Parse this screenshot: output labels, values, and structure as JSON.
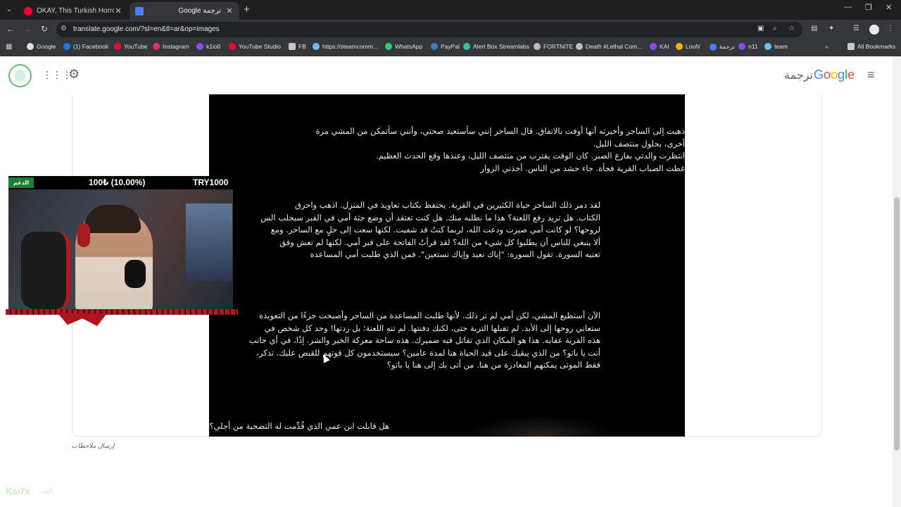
{
  "browser": {
    "tabs": [
      {
        "title": "OKAY, This Turkish Horror Game",
        "icon": "youtube-icon",
        "active": false
      },
      {
        "title": "Google ترجمة",
        "icon": "google-translate-icon",
        "active": true
      }
    ],
    "url": "translate.google.com/?sl=en&tl=ar&op=images",
    "bookmarks": [
      {
        "label": "Google",
        "icon": "google-icon",
        "color": "#dddddd"
      },
      {
        "label": "(1) Facebook",
        "icon": "facebook-icon",
        "color": "#1877f2"
      },
      {
        "label": "YouTube",
        "icon": "youtube-icon",
        "color": "#ff0033"
      },
      {
        "label": "Instagram",
        "icon": "instagram-icon",
        "color": "#e1306c"
      },
      {
        "label": "k1io0",
        "icon": "twitch-icon",
        "color": "#9146ff"
      },
      {
        "label": "YouTube Studio",
        "icon": "youtube-studio-icon",
        "color": "#ff0033"
      },
      {
        "label": "FB",
        "icon": "folder-icon",
        "color": "#c8c8c8"
      },
      {
        "label": "https://steamcomm...",
        "icon": "steam-icon",
        "color": "#66c0f4"
      },
      {
        "label": "WhatsApp",
        "icon": "whatsapp-icon",
        "color": "#25d366"
      },
      {
        "label": "PayPal",
        "icon": "paypal-icon",
        "color": "#3b7bbf"
      },
      {
        "label": "Alert Box Streamlabs",
        "icon": "streamlabs-icon",
        "color": "#31c3a2"
      },
      {
        "label": "FORTNITE",
        "icon": "fortnite-icon",
        "color": "#bbbbbb"
      },
      {
        "label": "Death #Lethal Com...",
        "icon": "discord-icon",
        "color": "#bbbbbb"
      },
      {
        "label": "KAI",
        "icon": "twitch-icon",
        "color": "#9146ff"
      },
      {
        "label": "LooN",
        "icon": "loon-icon",
        "color": "#f4b400"
      },
      {
        "label": "ترجمة",
        "icon": "google-translate-icon",
        "color": "#4c7ef0"
      },
      {
        "label": "n11",
        "icon": "twitch-icon",
        "color": "#9146ff"
      },
      {
        "label": "team",
        "icon": "steam-icon",
        "color": "#66c0f4"
      }
    ],
    "all_bookmarks": "All Bookmarks"
  },
  "translate": {
    "logo_word": "ترجمة",
    "logo_letters": [
      "G",
      "o",
      "o",
      "g",
      "l",
      "e"
    ],
    "feedback": "إرسال ملاحظات",
    "paragraphs": [
      {
        "lines": [
          "ذهبت إلى الساحر وأخبرته أنها أوفت بالاتفاق. قال الساحر إنني سأستعيد صحتي، وأنني سأتمكن من المشي مرة",
          "أخرى، بحلول منتصف الليل.",
          "انتظرت والدتي بفارغ الصبر. كان الوقت يقترب من منتصف الليل، وعندها وقع الحدث العظيم.",
          "غطت الضباب القرية فجأة. جاء حشد من الناس. أخذني الزوار"
        ]
      },
      {
        "lines": [
          "لقد دمر ذلك الساحر حياة الكثيرين في القرية. يحتفظ بكتاب تعاويذ في المنزل. اذهب واحرق",
          "الكتاب. هل تريد رفع اللعنة؟ هذا ما نطلبه منك. هل كنت تعتقد أن وضع جثة أمي في القبر سيجلب الس",
          "لروحها؟ لو كانت أمي صبرت ودعت الله، لربما كنتُ قد شفيت. لكنها سعت إلى حلٍ مع الساحر. ومع",
          "ألا ينبغي للناس أن يطلبوا كل شيء من الله؟ لقد قرأتُ الفاتحة على قبر أمي. لكنها لم تعش وفق",
          "تعنيه السورة. تقول السورة: \"إياك نعبد وإياك نستعين\". فمن الذي طلبت أمي المساعدة"
        ]
      },
      {
        "lines": [
          "الآن أستطيع المشي، لكن أمي لم تر ذلك. لأنها طلبت المساعدة من الساحر وأصبحت جزءًا من التعويذة",
          "ستعاني روحها إلى الأبد. لم تقبلها التربة حتى، لكنك دفنتها. لم تنهِ اللعنة؛ بل زدتها! وجد كل شخص في",
          "هذه القرية عقابه. هذا هو المكان الذي تقاتل فيه ضميرك. هذه ساحة معركة الخير والشر. إذًا، في أي جانب",
          "أنت يا باتو؟ من الذي يبقيك على قيد الحياة هنا لمدة عامين؟ سيستخدمون كل قوتهم للقبض عليك. تذكر،",
          "فقط الموتى يمكنهم المغادرة من هنا. من أتى بك إلى هنا يا باتو؟"
        ]
      },
      {
        "lines": [
          "هل قابلت ابن عمي الذي قُدِّمت له التضحية من أجلي؟"
        ]
      }
    ]
  },
  "overlay": {
    "support_label": "الدعم",
    "donation_progress": "100₺ (10.00%)",
    "donation_goal": "TRY1000",
    "watermark": "Kai7x",
    "watermark_sub": "البث"
  },
  "colors": {
    "accent_green": "#1e7e34",
    "stream_red": "#b0141e",
    "page_bg": "#ffffff",
    "image_bg": "#000000"
  }
}
